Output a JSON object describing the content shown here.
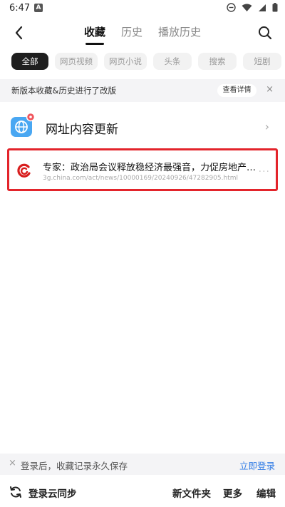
{
  "status_bar": {
    "time": "6:47",
    "badge": "A"
  },
  "header": {
    "tabs": [
      {
        "label": "收藏",
        "active": true
      },
      {
        "label": "历史",
        "active": false
      },
      {
        "label": "播放历史",
        "active": false
      }
    ]
  },
  "chips": [
    "全部",
    "网页视频",
    "网页小说",
    "头条",
    "搜索",
    "短剧"
  ],
  "notice": {
    "text": "新版本收藏&历史进行了改版",
    "detail_label": "查看详情",
    "close": "×"
  },
  "site_update": {
    "label": "网址内容更新",
    "chevron": "›"
  },
  "favorite": {
    "title": "专家：政治局会议释放稳经济最强音，力促房地产止...",
    "url": "3g.china.com/act/news/10000169/20240926/47282905.html",
    "more": "···"
  },
  "login_banner": {
    "close": "×",
    "text": "登录后，收藏记录永久保存",
    "link": "立即登录"
  },
  "bottom_bar": {
    "sync": "登录云同步",
    "new_folder": "新文件夹",
    "more": "更多",
    "edit": "编辑"
  },
  "colors": {
    "highlight": "#e3242b",
    "link": "#2f7be5",
    "active_chip": "#1f1f1f"
  }
}
